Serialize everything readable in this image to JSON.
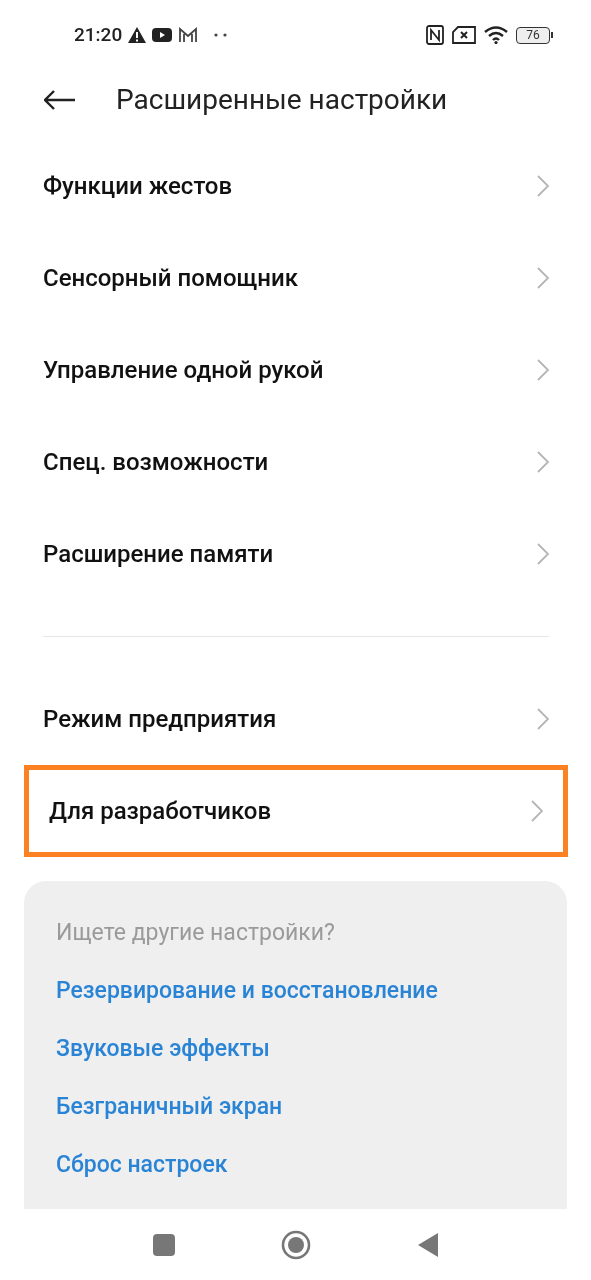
{
  "status_bar": {
    "time": "21:20",
    "battery": "76"
  },
  "header": {
    "title": "Расширенные настройки"
  },
  "groups": [
    {
      "items": [
        {
          "label": "Функции жестов",
          "highlighted": false
        },
        {
          "label": "Сенсорный помощник",
          "highlighted": false
        },
        {
          "label": "Управление одной рукой",
          "highlighted": false
        },
        {
          "label": "Спец. возможности",
          "highlighted": false
        },
        {
          "label": "Расширение памяти",
          "highlighted": false
        }
      ]
    },
    {
      "items": [
        {
          "label": "Режим предприятия",
          "highlighted": false
        },
        {
          "label": "Для разработчиков",
          "highlighted": true
        }
      ]
    }
  ],
  "suggestions": {
    "heading": "Ищете другие настройки?",
    "links": [
      "Резервирование и восстановление",
      "Звуковые эффекты",
      "Безграничный экран",
      "Сброс настроек"
    ]
  }
}
